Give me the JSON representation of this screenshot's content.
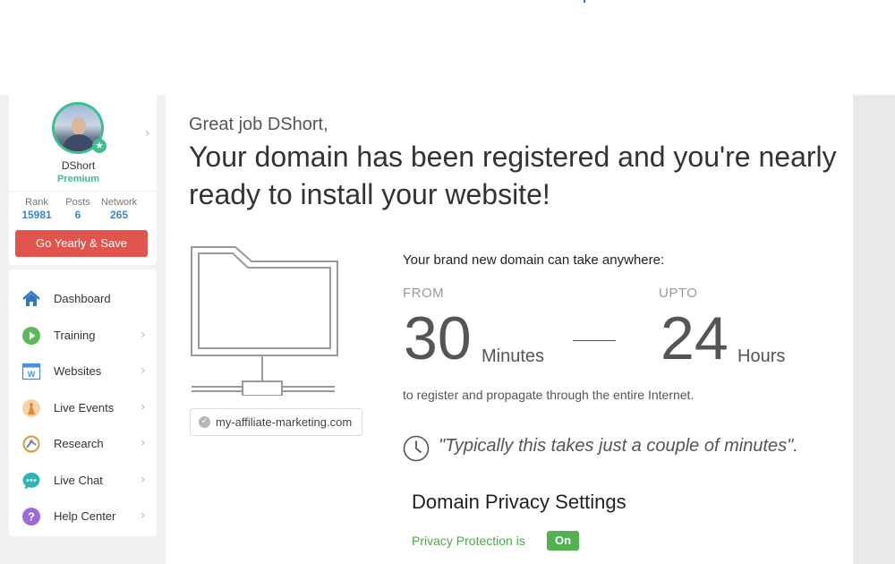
{
  "profile": {
    "username": "DShort",
    "tier": "Premium",
    "stats": [
      {
        "label": "Rank",
        "value": "15981"
      },
      {
        "label": "Posts",
        "value": "6"
      },
      {
        "label": "Network",
        "value": "265"
      }
    ],
    "cta_label": "Go Yearly & Save"
  },
  "nav": {
    "items": [
      {
        "label": "Dashboard",
        "icon": "home-icon"
      },
      {
        "label": "Training",
        "icon": "play-icon"
      },
      {
        "label": "Websites",
        "icon": "website-icon"
      },
      {
        "label": "Live Events",
        "icon": "live-events-icon"
      },
      {
        "label": "Research",
        "icon": "research-icon"
      },
      {
        "label": "Live Chat",
        "icon": "chat-icon"
      },
      {
        "label": "Help Center",
        "icon": "help-icon"
      }
    ]
  },
  "main": {
    "greeting": "Great job DShort,",
    "headline": "Your domain has been registered and you're nearly ready to install your website!",
    "domain": "my-affiliate-marketing.com",
    "intro": "Your brand new domain can take anywhere:",
    "from_label": "FROM",
    "from_value": "30",
    "from_unit": "Minutes",
    "upto_label": "UPTO",
    "upto_value": "24",
    "upto_unit": "Hours",
    "propagate_text": "to register and propagate through the entire Internet.",
    "quote": "\"Typically this takes just a couple of minutes\".",
    "privacy_title": "Domain Privacy Settings",
    "privacy_label": "Privacy Protection is",
    "privacy_state": "On"
  },
  "colors": {
    "accent_green": "#3fbf8a",
    "cta_red": "#e0554e",
    "stat_blue": "#3a86c8",
    "toggle_green": "#52b152"
  }
}
